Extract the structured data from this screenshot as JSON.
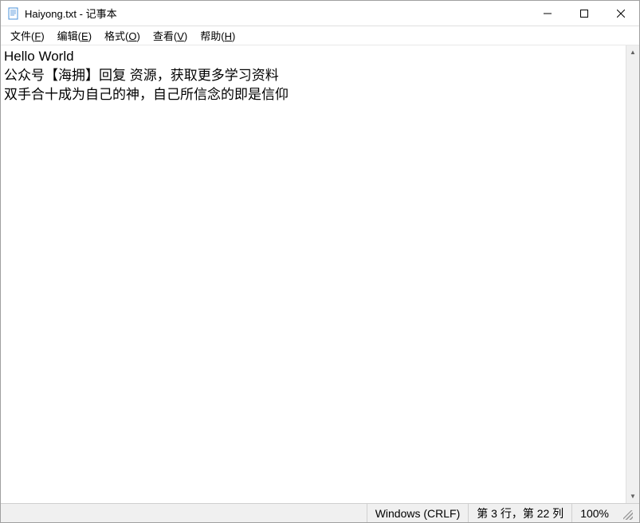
{
  "titlebar": {
    "title": "Haiyong.txt - 记事本"
  },
  "menubar": {
    "file": {
      "label": "文件",
      "accelerator": "F"
    },
    "edit": {
      "label": "编辑",
      "accelerator": "E"
    },
    "format": {
      "label": "格式",
      "accelerator": "O"
    },
    "view": {
      "label": "查看",
      "accelerator": "V"
    },
    "help": {
      "label": "帮助",
      "accelerator": "H"
    }
  },
  "content": {
    "text": "Hello World\n公众号【海拥】回复 资源，获取更多学习资料\n双手合十成为自己的神，自己所信念的即是信仰"
  },
  "statusbar": {
    "encoding": "Windows (CRLF)",
    "position": "第 3 行，第 22 列",
    "zoom": "100%"
  }
}
